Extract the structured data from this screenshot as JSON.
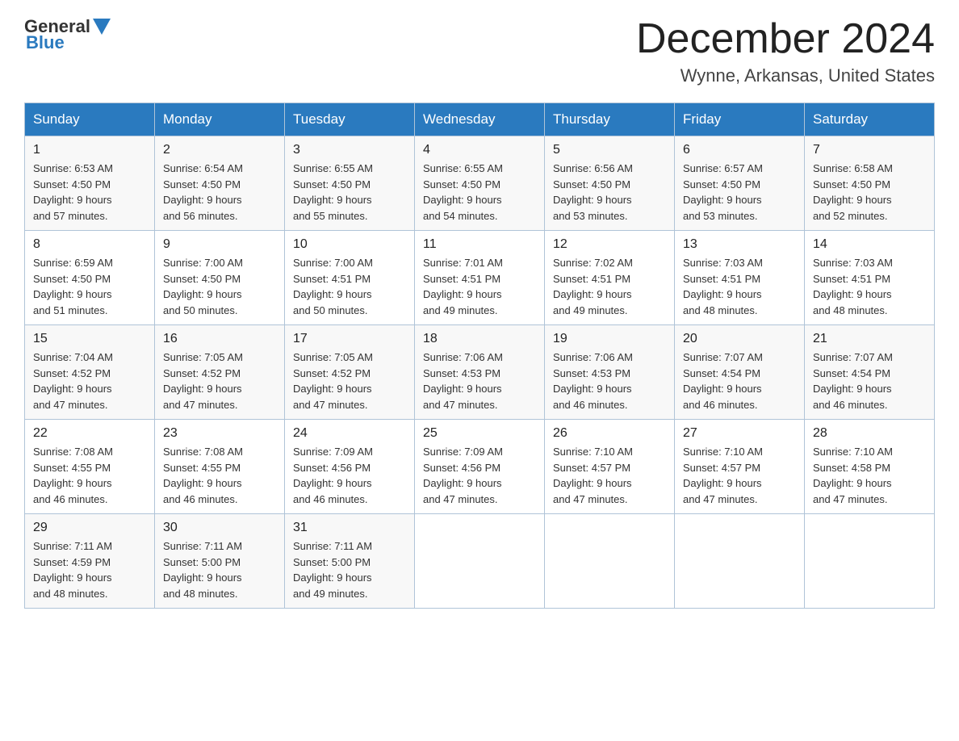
{
  "logo": {
    "text_general": "General",
    "text_blue": "Blue",
    "alt": "GeneralBlue logo"
  },
  "header": {
    "month": "December 2024",
    "location": "Wynne, Arkansas, United States"
  },
  "weekdays": [
    "Sunday",
    "Monday",
    "Tuesday",
    "Wednesday",
    "Thursday",
    "Friday",
    "Saturday"
  ],
  "weeks": [
    [
      {
        "day": "1",
        "sunrise": "6:53 AM",
        "sunset": "4:50 PM",
        "daylight": "9 hours and 57 minutes."
      },
      {
        "day": "2",
        "sunrise": "6:54 AM",
        "sunset": "4:50 PM",
        "daylight": "9 hours and 56 minutes."
      },
      {
        "day": "3",
        "sunrise": "6:55 AM",
        "sunset": "4:50 PM",
        "daylight": "9 hours and 55 minutes."
      },
      {
        "day": "4",
        "sunrise": "6:55 AM",
        "sunset": "4:50 PM",
        "daylight": "9 hours and 54 minutes."
      },
      {
        "day": "5",
        "sunrise": "6:56 AM",
        "sunset": "4:50 PM",
        "daylight": "9 hours and 53 minutes."
      },
      {
        "day": "6",
        "sunrise": "6:57 AM",
        "sunset": "4:50 PM",
        "daylight": "9 hours and 53 minutes."
      },
      {
        "day": "7",
        "sunrise": "6:58 AM",
        "sunset": "4:50 PM",
        "daylight": "9 hours and 52 minutes."
      }
    ],
    [
      {
        "day": "8",
        "sunrise": "6:59 AM",
        "sunset": "4:50 PM",
        "daylight": "9 hours and 51 minutes."
      },
      {
        "day": "9",
        "sunrise": "7:00 AM",
        "sunset": "4:50 PM",
        "daylight": "9 hours and 50 minutes."
      },
      {
        "day": "10",
        "sunrise": "7:00 AM",
        "sunset": "4:51 PM",
        "daylight": "9 hours and 50 minutes."
      },
      {
        "day": "11",
        "sunrise": "7:01 AM",
        "sunset": "4:51 PM",
        "daylight": "9 hours and 49 minutes."
      },
      {
        "day": "12",
        "sunrise": "7:02 AM",
        "sunset": "4:51 PM",
        "daylight": "9 hours and 49 minutes."
      },
      {
        "day": "13",
        "sunrise": "7:03 AM",
        "sunset": "4:51 PM",
        "daylight": "9 hours and 48 minutes."
      },
      {
        "day": "14",
        "sunrise": "7:03 AM",
        "sunset": "4:51 PM",
        "daylight": "9 hours and 48 minutes."
      }
    ],
    [
      {
        "day": "15",
        "sunrise": "7:04 AM",
        "sunset": "4:52 PM",
        "daylight": "9 hours and 47 minutes."
      },
      {
        "day": "16",
        "sunrise": "7:05 AM",
        "sunset": "4:52 PM",
        "daylight": "9 hours and 47 minutes."
      },
      {
        "day": "17",
        "sunrise": "7:05 AM",
        "sunset": "4:52 PM",
        "daylight": "9 hours and 47 minutes."
      },
      {
        "day": "18",
        "sunrise": "7:06 AM",
        "sunset": "4:53 PM",
        "daylight": "9 hours and 47 minutes."
      },
      {
        "day": "19",
        "sunrise": "7:06 AM",
        "sunset": "4:53 PM",
        "daylight": "9 hours and 46 minutes."
      },
      {
        "day": "20",
        "sunrise": "7:07 AM",
        "sunset": "4:54 PM",
        "daylight": "9 hours and 46 minutes."
      },
      {
        "day": "21",
        "sunrise": "7:07 AM",
        "sunset": "4:54 PM",
        "daylight": "9 hours and 46 minutes."
      }
    ],
    [
      {
        "day": "22",
        "sunrise": "7:08 AM",
        "sunset": "4:55 PM",
        "daylight": "9 hours and 46 minutes."
      },
      {
        "day": "23",
        "sunrise": "7:08 AM",
        "sunset": "4:55 PM",
        "daylight": "9 hours and 46 minutes."
      },
      {
        "day": "24",
        "sunrise": "7:09 AM",
        "sunset": "4:56 PM",
        "daylight": "9 hours and 46 minutes."
      },
      {
        "day": "25",
        "sunrise": "7:09 AM",
        "sunset": "4:56 PM",
        "daylight": "9 hours and 47 minutes."
      },
      {
        "day": "26",
        "sunrise": "7:10 AM",
        "sunset": "4:57 PM",
        "daylight": "9 hours and 47 minutes."
      },
      {
        "day": "27",
        "sunrise": "7:10 AM",
        "sunset": "4:57 PM",
        "daylight": "9 hours and 47 minutes."
      },
      {
        "day": "28",
        "sunrise": "7:10 AM",
        "sunset": "4:58 PM",
        "daylight": "9 hours and 47 minutes."
      }
    ],
    [
      {
        "day": "29",
        "sunrise": "7:11 AM",
        "sunset": "4:59 PM",
        "daylight": "9 hours and 48 minutes."
      },
      {
        "day": "30",
        "sunrise": "7:11 AM",
        "sunset": "5:00 PM",
        "daylight": "9 hours and 48 minutes."
      },
      {
        "day": "31",
        "sunrise": "7:11 AM",
        "sunset": "5:00 PM",
        "daylight": "9 hours and 49 minutes."
      },
      null,
      null,
      null,
      null
    ]
  ],
  "labels": {
    "sunrise": "Sunrise:",
    "sunset": "Sunset:",
    "daylight": "Daylight:"
  }
}
